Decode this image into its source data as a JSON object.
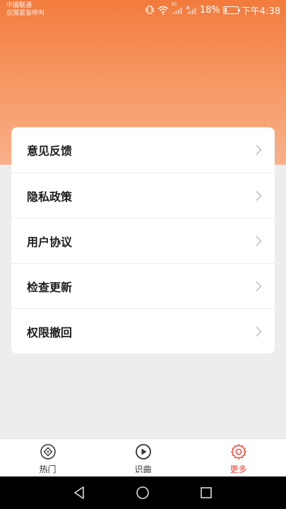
{
  "status_bar": {
    "carrier_line1": "中国联通",
    "carrier_line2": "仅限紧急呼叫",
    "network_badge": "3G",
    "battery": "18%",
    "battery_level": 0.18,
    "time": "下午4:38"
  },
  "menu": {
    "items": [
      {
        "label": "意见反馈"
      },
      {
        "label": "隐私政策"
      },
      {
        "label": "用户协议"
      },
      {
        "label": "检查更新"
      },
      {
        "label": "权限撤回"
      }
    ]
  },
  "tabs": [
    {
      "label": "热门",
      "icon": "compass-icon",
      "active": false
    },
    {
      "label": "识曲",
      "icon": "play-circle-icon",
      "active": false
    },
    {
      "label": "更多",
      "icon": "gear-icon",
      "active": true
    }
  ],
  "colors": {
    "header_top": "#f27b3d",
    "header_bottom": "#f9b08b",
    "active_tab": "#e84a3a",
    "background": "#ededed"
  }
}
